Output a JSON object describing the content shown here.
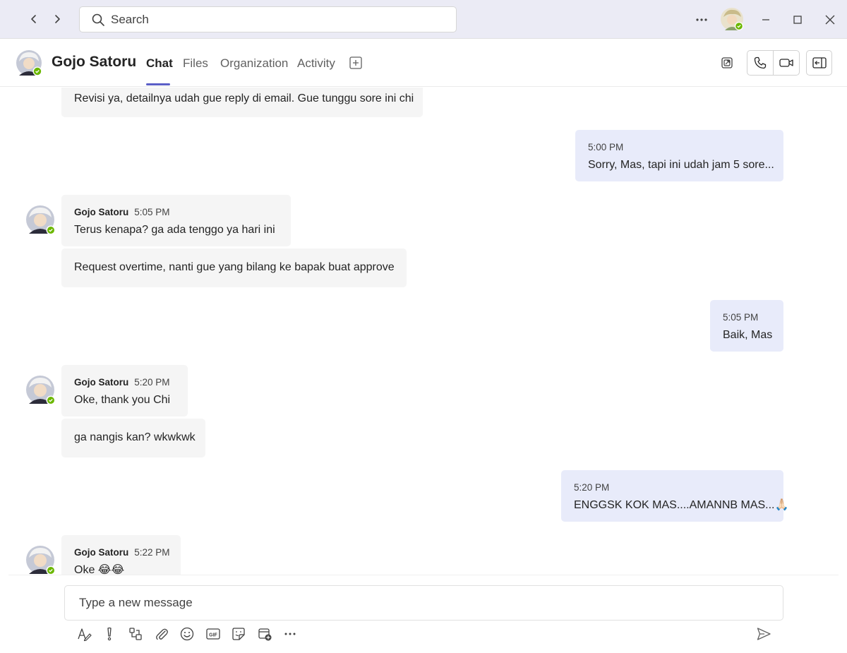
{
  "search": {
    "placeholder": "Search"
  },
  "header": {
    "name": "Gojo Satoru",
    "tabs": [
      {
        "label": "Chat",
        "active": true
      },
      {
        "label": "Files"
      },
      {
        "label": "Organization"
      },
      {
        "label": "Activity"
      }
    ]
  },
  "colors": {
    "accent": "#5b5fc7",
    "online": "#6bb700",
    "mine_bubble": "#e8ebfa",
    "their_bubble": "#f5f5f5"
  },
  "messages": [
    {
      "text": "Revisi ya, detailnya udah gue reply di email. Gue tunggu sore ini chi"
    },
    {
      "time": "5:00 PM",
      "text": "Sorry, Mas, tapi ini udah jam 5 sore..."
    },
    {
      "sender": "Gojo Satoru",
      "time": "5:05 PM",
      "text": "Terus kenapa? ga ada tenggo ya hari ini"
    },
    {
      "text": "Request overtime, nanti gue yang bilang ke bapak buat approve"
    },
    {
      "time": "5:05 PM",
      "text": "Baik, Mas"
    },
    {
      "sender": "Gojo Satoru",
      "time": "5:20 PM",
      "text": "Oke, thank you Chi"
    },
    {
      "text": "ga nangis kan? wkwkwk"
    },
    {
      "time": "5:20 PM",
      "text": "ENGGSK KOK MAS....AMANNB MAS...🙏🏻"
    },
    {
      "sender": "Gojo Satoru",
      "time": "5:22 PM",
      "text": "Oke 😂😂"
    }
  ],
  "compose": {
    "placeholder": "Type a new message"
  }
}
